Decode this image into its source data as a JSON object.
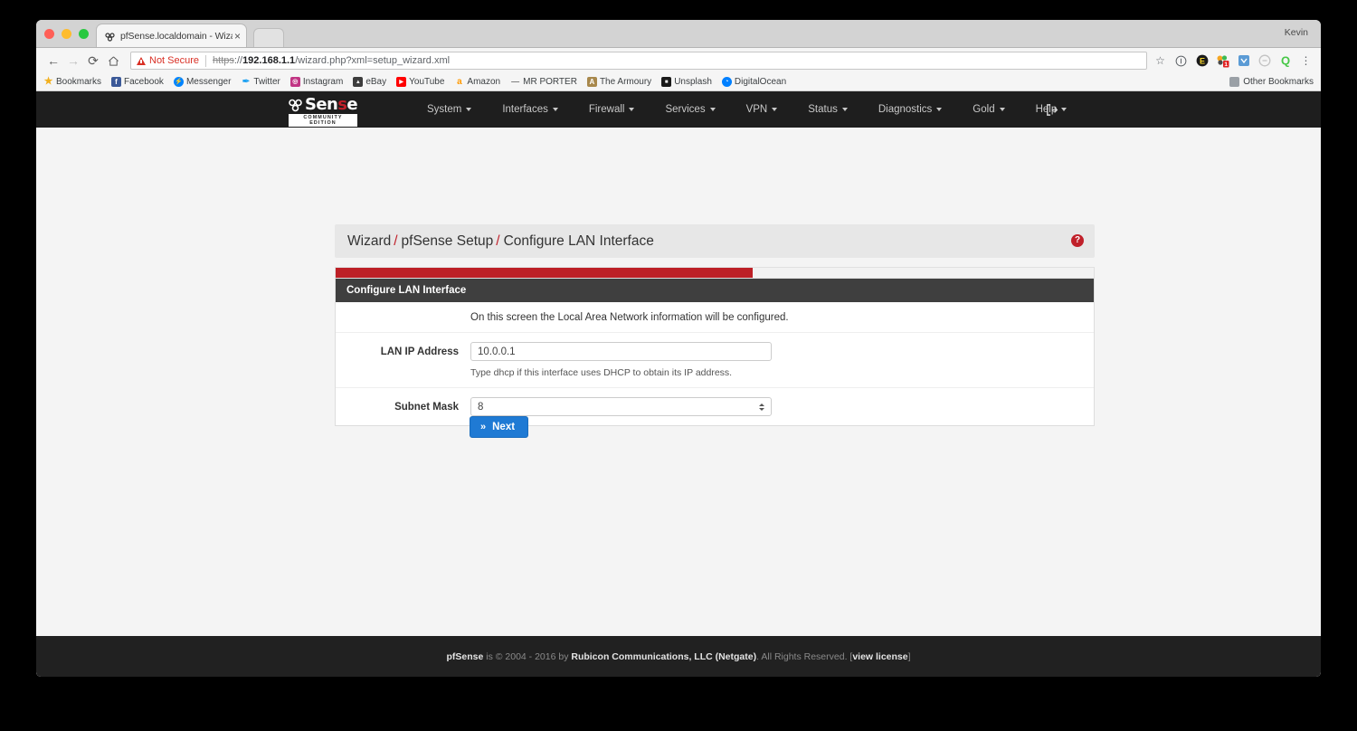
{
  "browser": {
    "user_label": "Kevin",
    "tab": {
      "title": "pfSense.localdomain - Wizard",
      "favicon_name": "pfsense-favicon",
      "close_label": "×"
    },
    "toolbar": {
      "back_label": "←",
      "forward_label": "→",
      "reload_label": "⟳",
      "home_label": "⌂",
      "security_label": "Not Secure",
      "url_scheme": "https",
      "url_sep": "://",
      "url_host": "192.168.1.1",
      "url_path": "/wizard.php?xml=setup_wizard.xml",
      "star_label": "☆",
      "menu_label": "⋮"
    },
    "extensions": [
      {
        "name": "info-circle-icon",
        "glyph": "ⓘ",
        "color": "#5f6368",
        "bg": "transparent"
      },
      {
        "name": "ebates-icon",
        "glyph": "€",
        "color": "#ffffff",
        "bg": "#1a1a1a"
      },
      {
        "name": "honey-icon",
        "glyph": "",
        "color": "#ffffff",
        "bg": "#f5a623"
      },
      {
        "name": "pocket-icon",
        "glyph": "◆",
        "color": "#ffffff",
        "bg": "#4a90d9"
      },
      {
        "name": "shield-icon",
        "glyph": "○",
        "color": "#b0b0b0",
        "bg": "transparent"
      },
      {
        "name": "quora-icon",
        "glyph": "Q",
        "color": "#ffffff",
        "bg": "#3ec93e"
      }
    ],
    "bookmarks": [
      {
        "label": "Bookmarks",
        "icon_name": "star-icon",
        "glyph": "★",
        "color": "#f2b01e",
        "bg": "transparent"
      },
      {
        "label": "Facebook",
        "icon_name": "facebook-icon",
        "glyph": "f",
        "color": "#ffffff",
        "bg": "#3b5998"
      },
      {
        "label": "Messenger",
        "icon_name": "messenger-icon",
        "glyph": "⚡",
        "color": "#ffffff",
        "bg": "#0084ff"
      },
      {
        "label": "Twitter",
        "icon_name": "twitter-icon",
        "glyph": "✒",
        "color": "#ffffff",
        "bg": "#1da1f2"
      },
      {
        "label": "Instagram",
        "icon_name": "instagram-icon",
        "glyph": "◎",
        "color": "#ffffff",
        "bg": "#c13584"
      },
      {
        "label": "eBay",
        "icon_name": "ebay-icon",
        "glyph": "▲",
        "color": "#ffffff",
        "bg": "#3d3d3d"
      },
      {
        "label": "YouTube",
        "icon_name": "youtube-icon",
        "glyph": "▶",
        "color": "#ffffff",
        "bg": "#ff0000"
      },
      {
        "label": "Amazon",
        "icon_name": "amazon-icon",
        "glyph": "a",
        "color": "#ffffff",
        "bg": "#ff9900"
      },
      {
        "label": "MR PORTER",
        "icon_name": "mrporter-icon",
        "glyph": "—",
        "color": "#666666",
        "bg": "transparent"
      },
      {
        "label": "The Armoury",
        "icon_name": "armoury-icon",
        "glyph": "A",
        "color": "#ffffff",
        "bg": "#a8884c"
      },
      {
        "label": "Unsplash",
        "icon_name": "unsplash-icon",
        "glyph": "■",
        "color": "#ffffff",
        "bg": "#1a1a1a"
      },
      {
        "label": "DigitalOcean",
        "icon_name": "digitalocean-icon",
        "glyph": "◔",
        "color": "#ffffff",
        "bg": "#0080ff"
      }
    ],
    "other_bookmarks_label": "Other Bookmarks"
  },
  "pfsense": {
    "logo": {
      "text_before": "Sen",
      "text_accent": "s",
      "text_after": "e",
      "subtitle": "COMMUNITY EDITION"
    },
    "nav_items": [
      {
        "label": "System",
        "has_caret": true
      },
      {
        "label": "Interfaces",
        "has_caret": true
      },
      {
        "label": "Firewall",
        "has_caret": true
      },
      {
        "label": "Services",
        "has_caret": true
      },
      {
        "label": "VPN",
        "has_caret": true
      },
      {
        "label": "Status",
        "has_caret": true
      },
      {
        "label": "Diagnostics",
        "has_caret": true
      },
      {
        "label": "Gold",
        "has_caret": true
      },
      {
        "label": "Help",
        "has_caret": true
      }
    ],
    "logout_icon_label": "⇥",
    "breadcrumb": {
      "items": [
        "Wizard",
        "pfSense Setup",
        "Configure LAN Interface"
      ],
      "separator": "/",
      "help_badge": "?"
    },
    "progress": {
      "percent": 55,
      "color": "#bd2026"
    },
    "panel": {
      "title": "Configure LAN Interface",
      "intro": "On this screen the Local Area Network information will be configured.",
      "fields": [
        {
          "label": "LAN IP Address",
          "value": "10.0.0.1",
          "help": "Type dhcp if this interface uses DHCP to obtain its IP address.",
          "type": "text"
        },
        {
          "label": "Subnet Mask",
          "value": "8",
          "help": "",
          "type": "select"
        }
      ]
    },
    "next_button": {
      "label": "Next",
      "icon": "»",
      "color": "#1f7ad4"
    },
    "footer": {
      "brand": "pfSense",
      "text_1": " is © 2004 - 2016 by ",
      "company": "Rubicon Communications, LLC (Netgate)",
      "text_2": ". All Rights Reserved. [",
      "license_link": "view license",
      "text_3": "]"
    }
  }
}
